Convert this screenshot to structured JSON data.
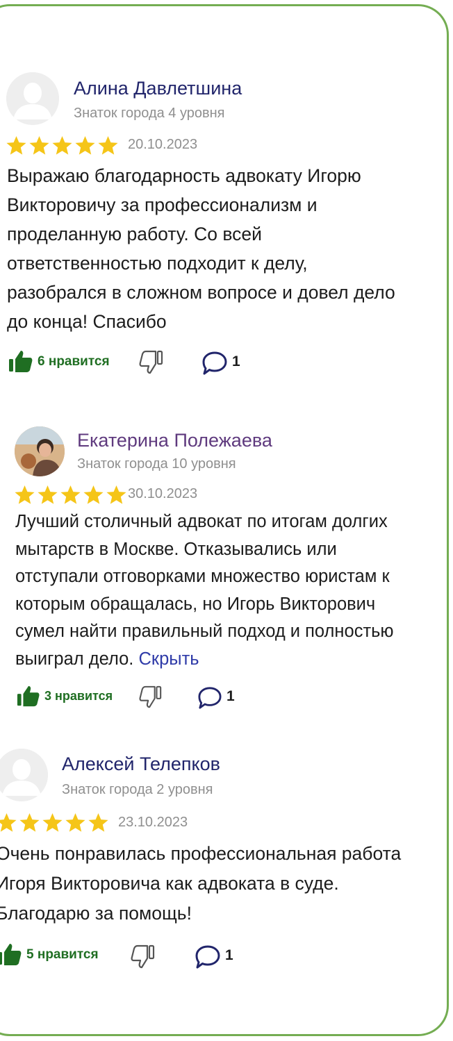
{
  "reviews": [
    {
      "author": "Алина Давлетшина",
      "level": "Знаток города 4 уровня",
      "date": "20.10.2023",
      "rating": 5,
      "text_lines": [
        "Выражаю благодарность адвокату Игорю",
        "Викторовичу за профессионализм и",
        "проделанную работу. Со всей",
        "ответственностью подходит к делу,",
        "разобрался в сложном вопросе и довел дело",
        "до конца! Спасибо"
      ],
      "likes": "6 нравится",
      "comments": "1"
    },
    {
      "author": "Екатерина Полежаева",
      "level": "Знаток города 10 уровня",
      "date": "30.10.2023",
      "rating": 5,
      "text_lines": [
        "Лучший столичный адвокат по итогам долгих",
        "мытарств в Москве. Отказывались или",
        "отступали отговорками множество юристам к",
        "которым обращалась, но Игорь Викторович",
        "сумел найти правильный подход и полностью",
        "выиграл дело."
      ],
      "hide_label": "Скрыть",
      "likes": "3 нравится",
      "comments": "1"
    },
    {
      "author": "Алексей Телепков",
      "level": "Знаток города 2 уровня",
      "date": "23.10.2023",
      "rating": 5,
      "text_lines": [
        "Очень понравилась профессиональная работа",
        "Игоря Викторовича как адвоката в суде.",
        "Благодарю за помощь!"
      ],
      "likes": "5 нравится",
      "comments": "1"
    }
  ],
  "colors": {
    "star": "#f5c518",
    "author": "#21256b",
    "like": "#1f6e22",
    "link": "#2f3ba8",
    "frame": "#74ad52"
  }
}
